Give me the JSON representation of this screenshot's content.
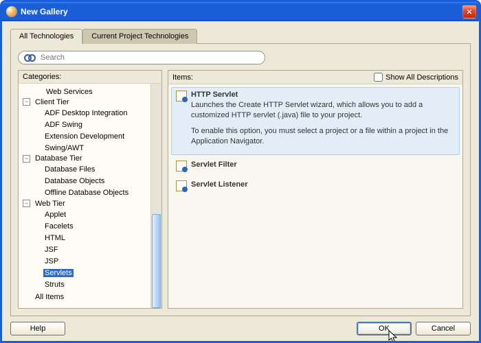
{
  "window": {
    "title": "New Gallery"
  },
  "tabs": {
    "all": "All Technologies",
    "current": "Current Project Technologies",
    "active": 0
  },
  "search": {
    "placeholder": "Search",
    "value": ""
  },
  "categoriesLabel": "Categories:",
  "itemsLabel": "Items:",
  "showAllDesc": {
    "label": "Show All Descriptions",
    "checked": false
  },
  "tree": {
    "partialTop": "Web Services",
    "nodes": [
      {
        "label": "Client Tier",
        "expanded": true,
        "children": [
          "ADF Desktop Integration",
          "ADF Swing",
          "Extension Development",
          "Swing/AWT"
        ]
      },
      {
        "label": "Database Tier",
        "expanded": true,
        "children": [
          "Database Files",
          "Database Objects",
          "Offline Database Objects"
        ]
      },
      {
        "label": "Web Tier",
        "expanded": true,
        "children": [
          "Applet",
          "Facelets",
          "HTML",
          "JSF",
          "JSP",
          "Servlets",
          "Struts"
        ]
      },
      {
        "label": "All Items",
        "expanded": false,
        "children": []
      }
    ],
    "selected": "Servlets"
  },
  "items": [
    {
      "title": "HTTP Servlet",
      "selected": true,
      "desc1": "Launches the Create HTTP Servlet wizard, which allows you to add a customized HTTP servlet (.java) file to your project.",
      "desc2": "To enable this option, you must select a project or a file within a project in the Application Navigator."
    },
    {
      "title": "Servlet Filter",
      "selected": false
    },
    {
      "title": "Servlet Listener",
      "selected": false
    }
  ],
  "buttons": {
    "help": "Help",
    "ok": "OK",
    "cancel": "Cancel"
  }
}
